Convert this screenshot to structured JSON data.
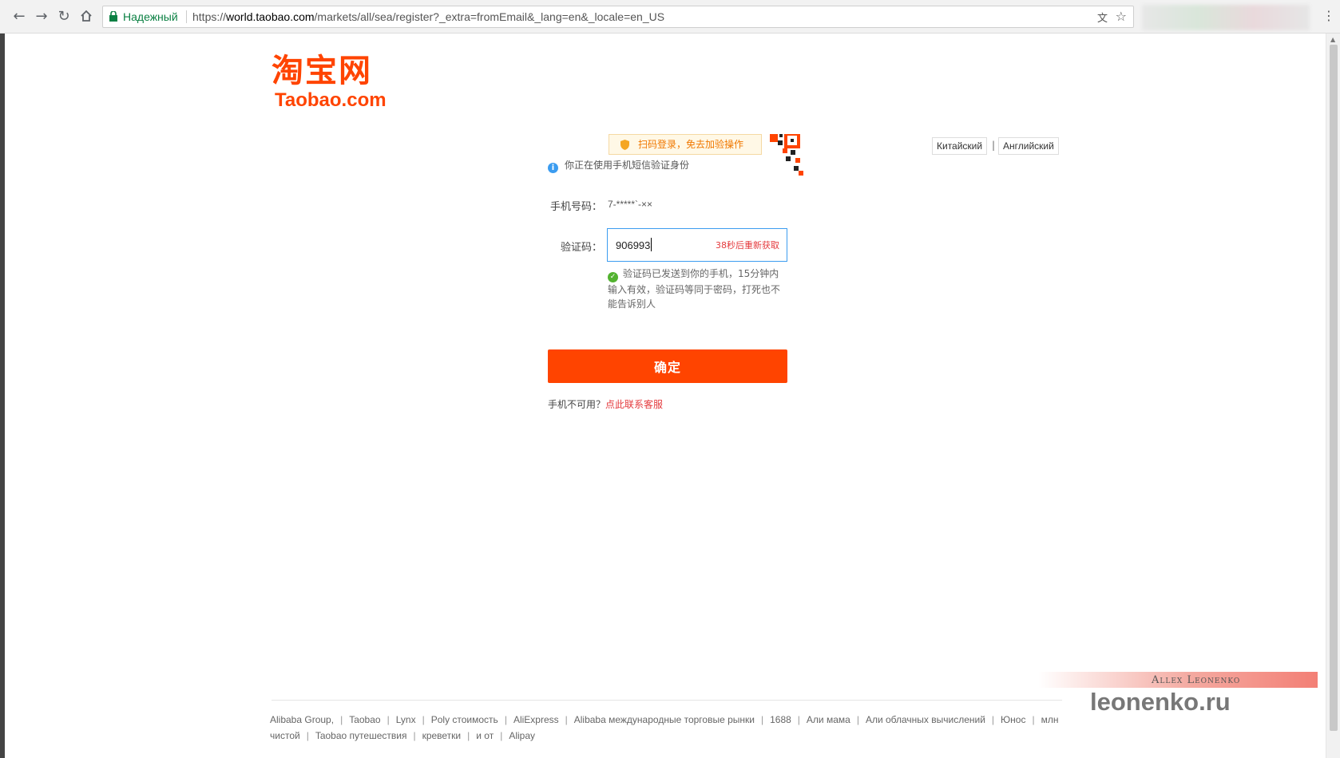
{
  "browser": {
    "secure_label": "Надежный",
    "url_prefix": "https://",
    "url_host": "world.taobao.com",
    "url_path": "/markets/all/sea/register?_extra=fromEmail&_lang=en&_locale=en_US"
  },
  "logo": {
    "cn": "淘宝网",
    "en": "Taobao.com"
  },
  "lang": {
    "chinese": "Китайский",
    "sep": "|",
    "english": "Английский"
  },
  "qr_hint": "扫码登录，免去加验操作",
  "info": "你正在使用手机短信验证身份",
  "form": {
    "phone_label": "手机号码：",
    "phone_value": "7-*****`-××",
    "code_label": "验证码：",
    "code_value": "906993",
    "resend": "38秒后重新获取",
    "ok_message": "验证码已发送到你的手机，15分钟内输入有效，验证码等同于密码，打死也不能告诉别人",
    "confirm": "确定"
  },
  "help": {
    "text": "手机不可用？",
    "link": "点此联系客服"
  },
  "watermark": {
    "small": "Allex Leonenko",
    "big": "leonenko.ru"
  },
  "footer": {
    "links": [
      "Alibaba Group,",
      "Taobao",
      "Lynx",
      "Poly стоимость",
      "AliExpress",
      "Alibaba международные торговые рынки",
      "1688",
      "Али мама",
      "Али облачных вычислений",
      "Юнос",
      "млн чистой",
      "Taobao путешествия",
      "креветки",
      "и от",
      "Alipay"
    ]
  },
  "colors": {
    "brand": "#ff4400",
    "link": "#e4393c",
    "focus": "#3b9cf0",
    "success": "#52b22f"
  }
}
